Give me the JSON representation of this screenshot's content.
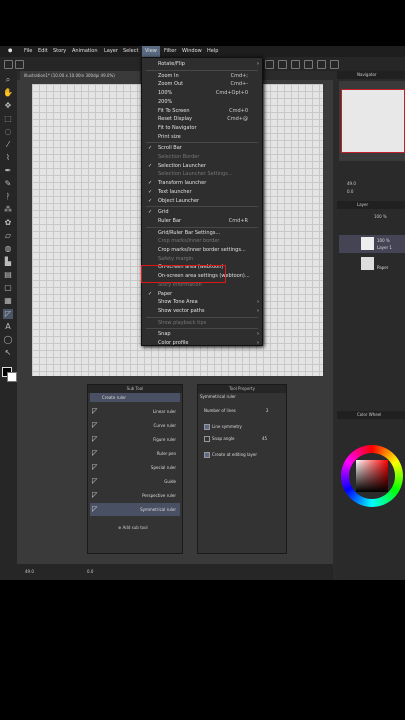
{
  "menubar": {
    "items": [
      "File",
      "Edit",
      "Story",
      "Animation",
      "Layer",
      "Select",
      "View",
      "Filter",
      "Window",
      "Help"
    ]
  },
  "document_tab": "Illustration1* (10.00 x 10.00in 300dpi 49.0%)",
  "view_menu": {
    "items": [
      {
        "label": "Rotate/Flip",
        "shortcut": "",
        "checked": false,
        "disabled": false,
        "arrow": true
      },
      {
        "label": "Zoom In",
        "shortcut": "Cmd+;",
        "checked": false,
        "disabled": false,
        "arrow": false
      },
      {
        "label": "Zoom Out",
        "shortcut": "Cmd+-",
        "checked": false,
        "disabled": false,
        "arrow": false
      },
      {
        "label": "100%",
        "shortcut": "Cmd+Opt+0",
        "checked": false,
        "disabled": false,
        "arrow": false
      },
      {
        "label": "200%",
        "shortcut": "",
        "checked": false,
        "disabled": false,
        "arrow": false
      },
      {
        "label": "Fit To Screen",
        "shortcut": "Cmd+0",
        "checked": false,
        "disabled": false,
        "arrow": false
      },
      {
        "label": "Reset Display",
        "shortcut": "Cmd+@",
        "checked": false,
        "disabled": false,
        "arrow": false
      },
      {
        "label": "Fit to Navigator",
        "shortcut": "",
        "checked": false,
        "disabled": false,
        "arrow": false
      },
      {
        "label": "Print size",
        "shortcut": "",
        "checked": false,
        "disabled": false,
        "arrow": false
      },
      {
        "label": "Scroll Bar",
        "shortcut": "",
        "checked": true,
        "disabled": false,
        "arrow": false
      },
      {
        "label": "Selection Border",
        "shortcut": "",
        "checked": false,
        "disabled": true,
        "arrow": false
      },
      {
        "label": "Selection Launcher",
        "shortcut": "",
        "checked": true,
        "disabled": false,
        "arrow": false
      },
      {
        "label": "Selection Launcher Settings...",
        "shortcut": "",
        "checked": false,
        "disabled": true,
        "arrow": false
      },
      {
        "label": "Transform launcher",
        "shortcut": "",
        "checked": true,
        "disabled": false,
        "arrow": false
      },
      {
        "label": "Text launcher",
        "shortcut": "",
        "checked": true,
        "disabled": false,
        "arrow": false
      },
      {
        "label": "Object Launcher",
        "shortcut": "",
        "checked": true,
        "disabled": false,
        "arrow": false
      },
      {
        "label": "Grid",
        "shortcut": "",
        "checked": true,
        "disabled": false,
        "arrow": false
      },
      {
        "label": "Ruler Bar",
        "shortcut": "Cmd+R",
        "checked": false,
        "disabled": false,
        "arrow": false
      },
      {
        "label": "Grid/Ruler Bar Settings...",
        "shortcut": "",
        "checked": false,
        "disabled": false,
        "arrow": false
      },
      {
        "label": "Crop marks/Inner border",
        "shortcut": "",
        "checked": false,
        "disabled": true,
        "arrow": false
      },
      {
        "label": "Crop marks/inner border settings...",
        "shortcut": "",
        "checked": false,
        "disabled": false,
        "arrow": false
      },
      {
        "label": "Safety margin",
        "shortcut": "",
        "checked": false,
        "disabled": true,
        "arrow": false
      },
      {
        "label": "On-screen area (webtoon)",
        "shortcut": "",
        "checked": false,
        "disabled": false,
        "arrow": false
      },
      {
        "label": "On-screen area settings (webtoon)...",
        "shortcut": "",
        "checked": false,
        "disabled": false,
        "arrow": false
      },
      {
        "label": "Story Information",
        "shortcut": "",
        "checked": false,
        "disabled": true,
        "arrow": false
      },
      {
        "label": "Paper",
        "shortcut": "",
        "checked": true,
        "disabled": false,
        "arrow": false
      },
      {
        "label": "Show Tone Area",
        "shortcut": "",
        "checked": false,
        "disabled": false,
        "arrow": true
      },
      {
        "label": "Show vector paths",
        "shortcut": "",
        "checked": false,
        "disabled": false,
        "arrow": true
      },
      {
        "label": "Show playback tips",
        "shortcut": "",
        "checked": false,
        "disabled": true,
        "arrow": false
      },
      {
        "label": "Snap",
        "shortcut": "",
        "checked": false,
        "disabled": false,
        "arrow": true
      },
      {
        "label": "Color profile",
        "shortcut": "",
        "checked": false,
        "disabled": false,
        "arrow": true
      }
    ]
  },
  "navigator": {
    "title": "Navigator",
    "zoom": "49.0",
    "angle": "0.0"
  },
  "layer_panel": {
    "title": "Layer",
    "blend_opacity": "100 %",
    "layers": [
      {
        "name": "Layer 1",
        "opacity": "100 %"
      },
      {
        "name": "Paper",
        "opacity": ""
      }
    ]
  },
  "color_wheel": {
    "title": "Color Wheel",
    "accent": "#c0202a"
  },
  "sub_tool": {
    "title": "Sub Tool",
    "items": [
      "Create ruler",
      "Linear ruler",
      "Curve ruler",
      "Figure ruler",
      "Ruler pen",
      "Special ruler",
      "Guide",
      "Perspective ruler",
      "Symmetrical ruler"
    ],
    "add_label": "Add sub tool"
  },
  "tool_property": {
    "title": "Tool Property",
    "tool_name": "Symmetrical ruler",
    "number_of_lines_label": "Number of lines",
    "number_of_lines_value": "2",
    "line_symmetry": "Line symmetry",
    "snap_angle": "Snap angle",
    "snap_angle_value": "45",
    "create_at_editing_layer": "Create at editing layer"
  },
  "bottom": {
    "zoom": "49.0",
    "angle": "0.0"
  }
}
